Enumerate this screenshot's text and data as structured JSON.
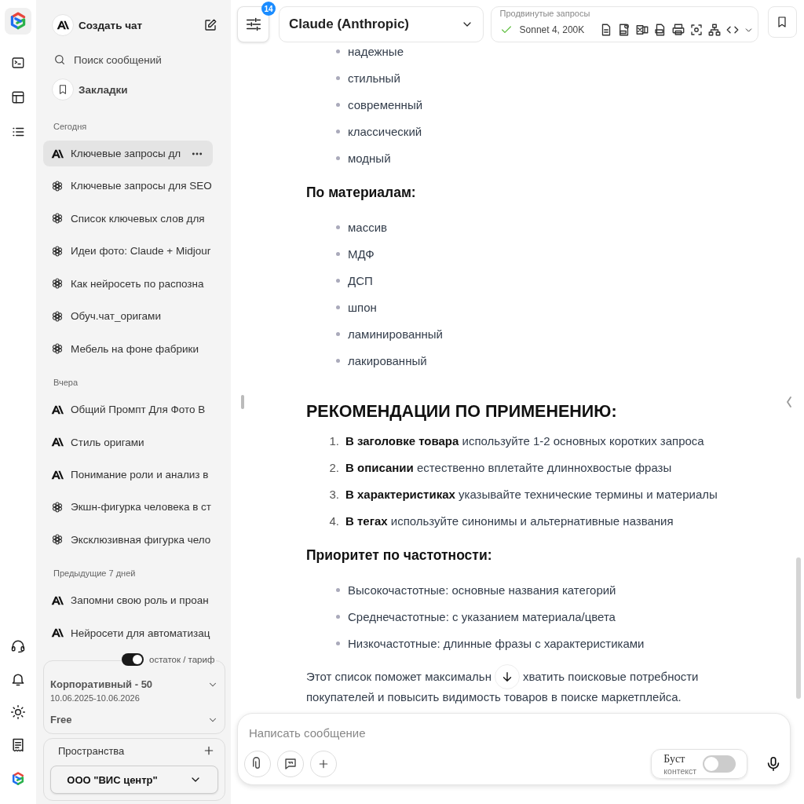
{
  "sidebar": {
    "new_chat": "Создать чат",
    "search": "Поиск сообщений",
    "bookmarks": "Закладки",
    "groups": [
      {
        "title": "Сегодня",
        "items": [
          {
            "title": "Ключевые запросы дл",
            "kind": "anthropic",
            "selected": true
          },
          {
            "title": "Ключевые запросы для SEO",
            "kind": "openai",
            "selected": false
          },
          {
            "title": "Список ключевых слов для",
            "kind": "openai",
            "selected": false
          },
          {
            "title": "Идеи фото: Claude + Midjour",
            "kind": "openai",
            "selected": false
          },
          {
            "title": "Как нейросеть по распозна",
            "kind": "openai",
            "selected": false
          },
          {
            "title": "Обуч.чат_оригами",
            "kind": "openai",
            "selected": false
          },
          {
            "title": "Мебель на фоне фабрики",
            "kind": "openai",
            "selected": false
          }
        ]
      },
      {
        "title": "Вчера",
        "items": [
          {
            "title": "Общий Промпт Для Фото В",
            "kind": "anthropic",
            "selected": false
          },
          {
            "title": "Стиль оригами",
            "kind": "anthropic",
            "selected": false
          },
          {
            "title": "Понимание роли и анализ в",
            "kind": "anthropic",
            "selected": false
          },
          {
            "title": "Экшн-фигурка человека в ст",
            "kind": "openai",
            "selected": false
          },
          {
            "title": "Эксклюзивная фигурка чело",
            "kind": "openai",
            "selected": false
          }
        ]
      },
      {
        "title": "Предыдущие 7 дней",
        "items": [
          {
            "title": "Запомни свою роль и проан",
            "kind": "anthropic",
            "selected": false
          },
          {
            "title": "Нейросети для автоматизац",
            "kind": "anthropic",
            "selected": false
          }
        ]
      }
    ],
    "plan_toggle": {
      "label": "остаток / тариф",
      "on": true
    },
    "plans": [
      {
        "name": "Корпоративный - 50",
        "dates": "10.06.2025-10.06.2026"
      },
      {
        "name": "Free"
      }
    ],
    "spaces": {
      "title": "Пространства",
      "value": "ООО \"ВИС центр\""
    }
  },
  "header": {
    "badge": "14",
    "model": "Claude (Anthropic)",
    "advanced": {
      "label": "Продвинутые запросы",
      "model": "Sonnet 4, 200K"
    }
  },
  "content": [
    {
      "kind": "bullets",
      "items": [
        "надежные",
        "стильный",
        "современный",
        "классический",
        "модный"
      ]
    },
    {
      "kind": "heading",
      "text": "По материалам:"
    },
    {
      "kind": "bullets",
      "items": [
        "массив",
        "МДФ",
        "ДСП",
        "шпон",
        "ламинированный",
        "лакированный"
      ]
    },
    {
      "kind": "title",
      "text": "РЕКОМЕНДАЦИИ ПО ПРИМЕНЕНИЮ:"
    },
    {
      "kind": "numbered",
      "items": [
        {
          "number": "1.",
          "text": "**В заголовке товара** используйте 1-2 основных коротких запроса"
        },
        {
          "number": "2.",
          "text": "**В описании** естественно вплетайте длиннохвостые фразы"
        },
        {
          "number": "3.",
          "text": "**В характеристиках** указывайте технические термины и материалы"
        },
        {
          "number": "4.",
          "text": "**В тегах** используйте синонимы и альтернативные названия"
        }
      ]
    },
    {
      "kind": "heading",
      "text": "Приоритет по частотности:"
    },
    {
      "kind": "bullets",
      "items": [
        "Высокочастотные: основные названия категорий",
        "Среднечастотные: с указанием материала/цвета",
        "Низкочастотные: длинные фразы с характеристиками"
      ]
    },
    {
      "kind": "paragraph",
      "parts": [
        "Этот список поможет максимальн",
        "хватить поисковые потребности",
        "покупателей и повысить видимость товаров в поиске маркетплейса."
      ]
    }
  ],
  "composer": {
    "placeholder": "Написать сообщение",
    "boost": {
      "label": "Буст",
      "sublabel": "контекст",
      "on": false
    }
  }
}
